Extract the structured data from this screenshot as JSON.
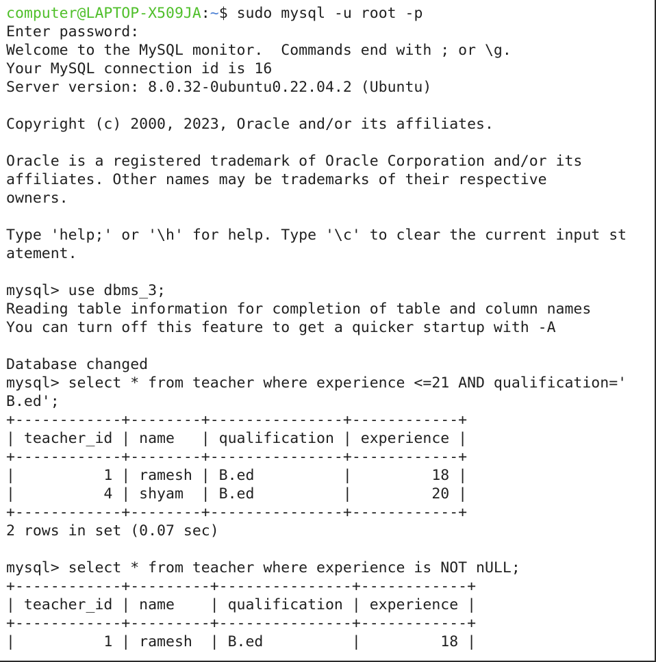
{
  "prompt": {
    "user_host": "computer@LAPTOP-X509JA",
    "separator": ":",
    "path": "~",
    "symbol": "$",
    "command": " sudo mysql -u root -p"
  },
  "colors": {
    "prompt_user": "#4fbf2a",
    "prompt_path": "#4a7fd4",
    "text": "#1f1f1f",
    "background": "#ffffff"
  },
  "lines": [
    "Enter password:",
    "Welcome to the MySQL monitor.  Commands end with ; or \\g.",
    "Your MySQL connection id is 16",
    "Server version: 8.0.32-0ubuntu0.22.04.2 (Ubuntu)",
    "",
    "Copyright (c) 2000, 2023, Oracle and/or its affiliates.",
    "",
    "Oracle is a registered trademark of Oracle Corporation and/or its",
    "affiliates. Other names may be trademarks of their respective",
    "owners.",
    "",
    "Type 'help;' or '\\h' for help. Type '\\c' to clear the current input st",
    "atement.",
    "",
    "mysql> use dbms_3;",
    "Reading table information for completion of table and column names",
    "You can turn off this feature to get a quicker startup with -A",
    "",
    "Database changed",
    "mysql> select * from teacher where experience <=21 AND qualification='",
    "B.ed';",
    "+------------+--------+---------------+------------+",
    "| teacher_id | name   | qualification | experience |",
    "+------------+--------+---------------+------------+",
    "|          1 | ramesh | B.ed          |         18 |",
    "|          4 | shyam  | B.ed          |         20 |",
    "+------------+--------+---------------+------------+",
    "2 rows in set (0.07 sec)",
    "",
    "mysql> select * from teacher where experience is NOT nULL;",
    "+------------+---------+---------------+------------+",
    "| teacher_id | name    | qualification | experience |",
    "+------------+---------+---------------+------------+",
    "|          1 | ramesh  | B.ed          |         18 |"
  ]
}
